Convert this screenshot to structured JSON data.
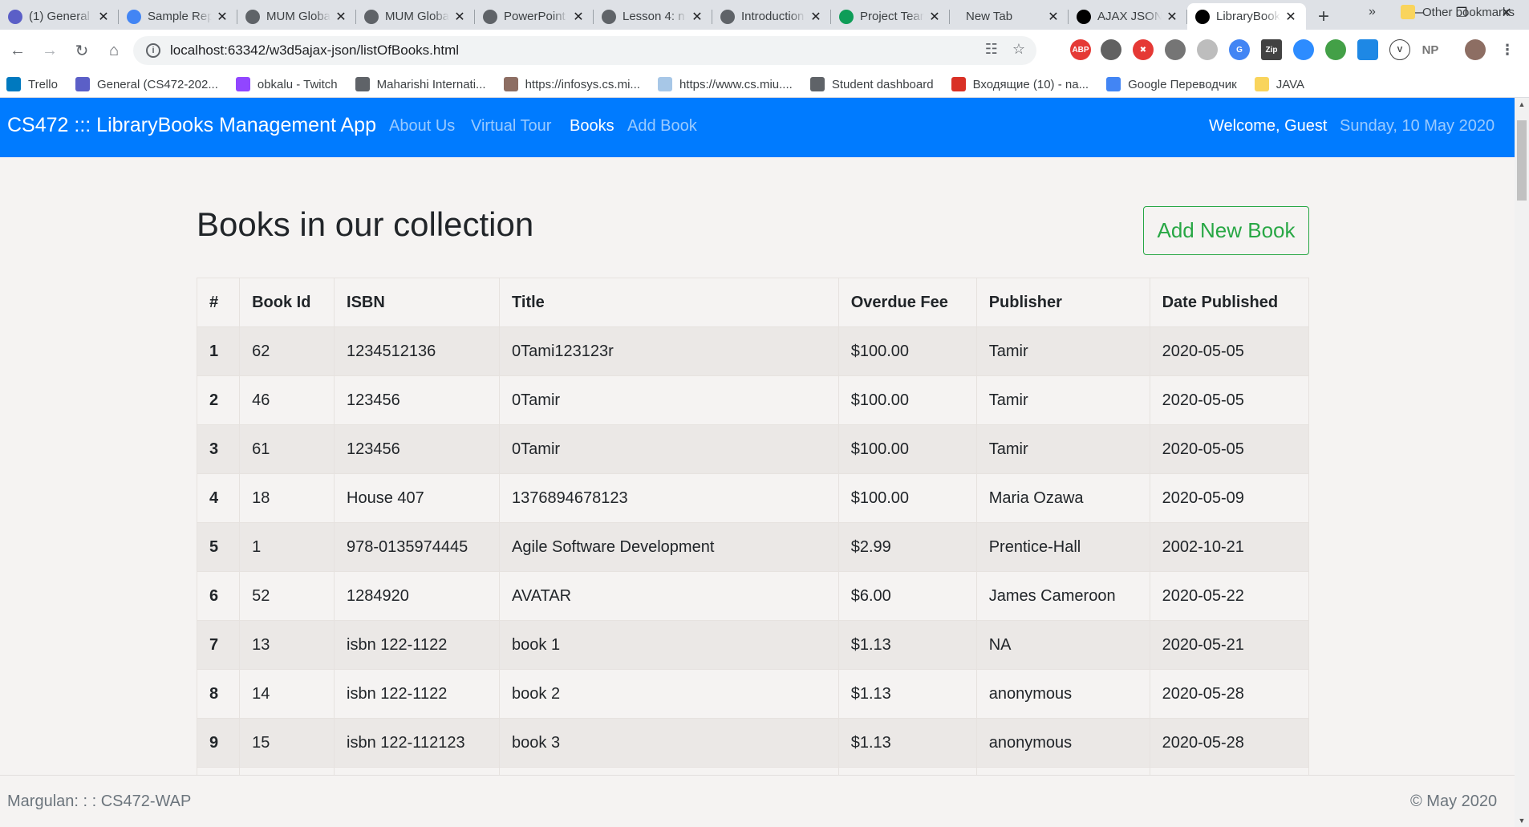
{
  "browser": {
    "tabs": [
      {
        "title": "(1) General",
        "icon": "teams-icon",
        "color": "#5b5fc7"
      },
      {
        "title": "Sample Report",
        "icon": "docs-icon",
        "color": "#4285f4"
      },
      {
        "title": "MUM Global",
        "icon": "globe-icon",
        "color": "#5f6368"
      },
      {
        "title": "MUM Global",
        "icon": "globe-icon",
        "color": "#5f6368"
      },
      {
        "title": "PowerPoint",
        "icon": "globe-icon",
        "color": "#5f6368"
      },
      {
        "title": "Lesson 4: n",
        "icon": "globe-icon",
        "color": "#5f6368"
      },
      {
        "title": "Introduction",
        "icon": "globe-icon",
        "color": "#5f6368"
      },
      {
        "title": "Project Team",
        "icon": "sheets-icon",
        "color": "#0f9d58"
      },
      {
        "title": "New Tab",
        "icon": "",
        "color": ""
      },
      {
        "title": "AJAX JSON",
        "icon": "intellij-icon",
        "color": "#000000"
      },
      {
        "title": "LibraryBooks",
        "icon": "intellij-icon",
        "color": "#000000",
        "active": true
      }
    ],
    "url": "localhost:63342/w3d5ajax-json/listOfBooks.html",
    "bookmarks": [
      {
        "label": "Trello",
        "icon": "trello-icon",
        "color": "#0079bf"
      },
      {
        "label": "General (CS472-202...",
        "icon": "teams-icon",
        "color": "#5b5fc7"
      },
      {
        "label": "obkalu - Twitch",
        "icon": "twitch-icon",
        "color": "#9146ff"
      },
      {
        "label": "Maharishi Internati...",
        "icon": "globe-icon",
        "color": "#5f6368"
      },
      {
        "label": "https://infosys.cs.mi...",
        "icon": "image-icon",
        "color": "#8d6e63"
      },
      {
        "label": "https://www.cs.miu....",
        "icon": "image-icon",
        "color": "#a7c7e7"
      },
      {
        "label": "Student dashboard",
        "icon": "globe-icon",
        "color": "#5f6368"
      },
      {
        "label": "Входящие (10) - na...",
        "icon": "gmail-icon",
        "color": "#d93025"
      },
      {
        "label": "Google Переводчик",
        "icon": "translate-icon",
        "color": "#4285f4"
      },
      {
        "label": "JAVA",
        "icon": "folder-icon",
        "color": "#f9d45c"
      }
    ],
    "bookmarks_more": "»",
    "other_bookmarks": "Other bookmarks"
  },
  "navbar": {
    "brand": "CS472 ::: LibraryBooks Management App",
    "links": [
      "About Us",
      "Virtual Tour",
      "Books",
      "Add Book"
    ],
    "active_link": "Books",
    "welcome": "Welcome, Guest",
    "date": "Sunday, 10 May 2020"
  },
  "main": {
    "title": "Books in our collection",
    "add_button": "Add New Book",
    "table": {
      "headers": [
        "#",
        "Book Id",
        "ISBN",
        "Title",
        "Overdue Fee",
        "Publisher",
        "Date Published"
      ],
      "rows": [
        [
          "1",
          "62",
          "1234512136",
          "0Tami123123r",
          "$100.00",
          "Tamir",
          "2020-05-05"
        ],
        [
          "2",
          "46",
          "123456",
          "0Tamir",
          "$100.00",
          "Tamir",
          "2020-05-05"
        ],
        [
          "3",
          "61",
          "123456",
          "0Tamir",
          "$100.00",
          "Tamir",
          "2020-05-05"
        ],
        [
          "4",
          "18",
          "House 407",
          "1376894678123",
          "$100.00",
          "Maria Ozawa",
          "2020-05-09"
        ],
        [
          "5",
          "1",
          "978-0135974445",
          "Agile Software Development",
          "$2.99",
          "Prentice-Hall",
          "2002-10-21"
        ],
        [
          "6",
          "52",
          "1284920",
          "AVATAR",
          "$6.00",
          "James Cameroon",
          "2020-05-22"
        ],
        [
          "7",
          "13",
          "isbn 122-1122",
          "book 1",
          "$1.13",
          "NA",
          "2020-05-21"
        ],
        [
          "8",
          "14",
          "isbn 122-1122",
          "book 2",
          "$1.13",
          "anonymous",
          "2020-05-28"
        ],
        [
          "9",
          "15",
          "isbn 122-112123",
          "book 3",
          "$1.13",
          "anonymous",
          "2020-05-28"
        ],
        [
          "",
          "",
          "",
          "",
          "",
          "",
          ""
        ]
      ]
    }
  },
  "footer": {
    "left": "Margulan: : : CS472-WAP",
    "right": "© May 2020"
  },
  "colors": {
    "navbar": "#007bff",
    "success": "#28a745",
    "page_bg": "#f5f3f2"
  }
}
